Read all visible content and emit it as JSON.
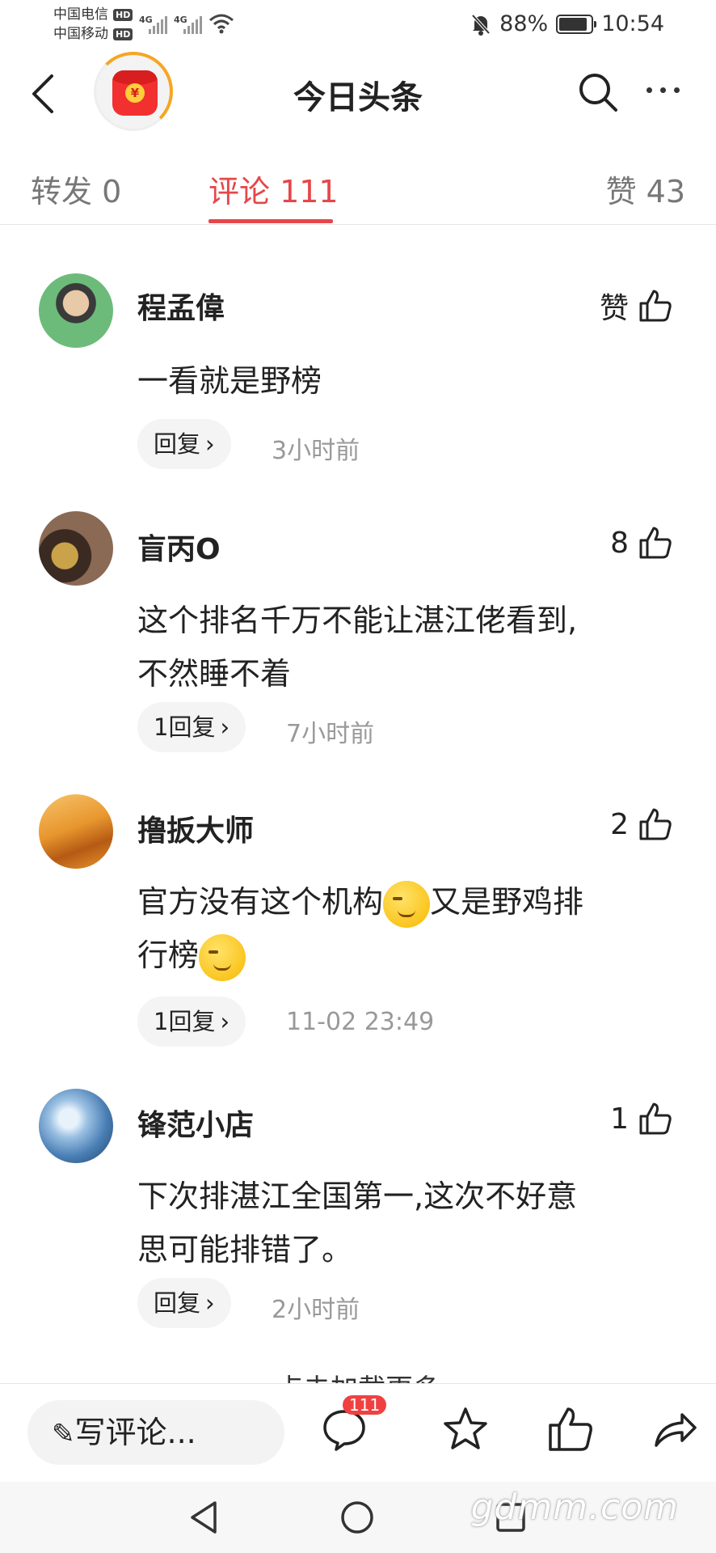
{
  "status_bar": {
    "carrier1": "中国电信",
    "carrier2": "中国移动",
    "hd_label": "HD",
    "net1": "4G",
    "net2": "4G",
    "battery": "88%",
    "time": "10:54"
  },
  "nav": {
    "title": "今日头条",
    "redpack_symbol": "¥"
  },
  "tabs": [
    {
      "label": "转发 0",
      "active": false
    },
    {
      "label": "评论 111",
      "active": true
    },
    {
      "label": "赞 43",
      "active": false
    }
  ],
  "comments": [
    {
      "name": "程孟偉",
      "likes": "赞",
      "text": "一看就是野榜",
      "reply": "回复",
      "time": "3小时前",
      "avatar_color": "#5ca86a"
    },
    {
      "name": "盲丙O",
      "likes": "8",
      "text_line1": "这个排名千万不能让湛江佬看到,",
      "text_line2": "不然睡不着",
      "reply": "1回复",
      "time": "7小时前",
      "avatar_color": "#6b4d3a"
    },
    {
      "name": "撸扳大师",
      "likes": "2",
      "text_part1": "官方没有这个机构",
      "text_part2": "又是野鸡排",
      "text_line2": "行榜",
      "reply": "1回复",
      "time": "11-02 23:49",
      "avatar_color": "#e8962e"
    },
    {
      "name": "锋范小店",
      "likes": "1",
      "text_line1": "下次排湛江全国第一,这次不好意",
      "text_line2": "思可能排错了。",
      "reply": "回复",
      "time": "2小时前",
      "avatar_color": "#4a7fb5"
    }
  ],
  "load_more": "点击加载更多",
  "bottom_bar": {
    "write_label": "写评论...",
    "comment_badge": "111"
  },
  "watermark": "gdmm.com"
}
